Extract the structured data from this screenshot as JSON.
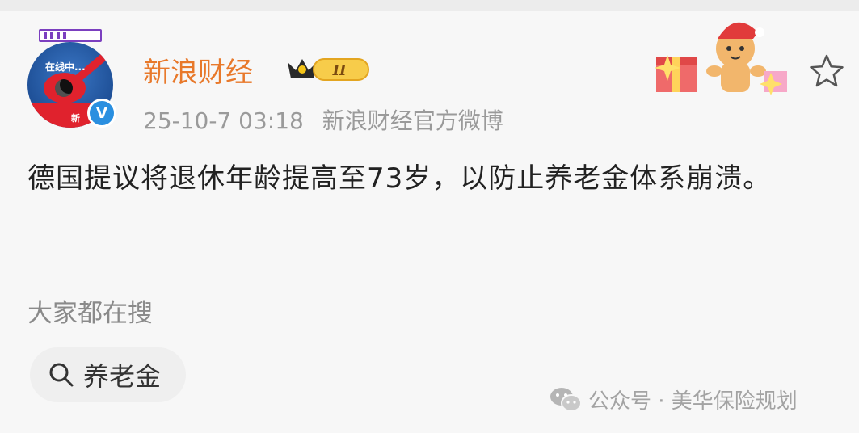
{
  "post": {
    "live_status": "在线中...",
    "avatar_mark": "新",
    "verified_mark": "V",
    "username": "新浪财经",
    "level_badge": "II",
    "timestamp": "25-10-7 03:18",
    "source": "新浪财经官方微博",
    "content": "德国提议将退休年龄提高至73岁，以防止养老金体系崩溃。"
  },
  "related": {
    "title": "大家都在搜",
    "chip_label": "养老金"
  },
  "watermark": "公众号 · 美华保险规划",
  "colors": {
    "username": "#e8792b",
    "meta": "#9a9a9a",
    "content": "#222222",
    "verify": "#2a8fe0"
  },
  "icons": [
    "live-bar-icon",
    "verified-icon",
    "crown-badge-icon",
    "gingerbread-decoration-icon",
    "star-icon",
    "search-icon",
    "wechat-icon"
  ]
}
